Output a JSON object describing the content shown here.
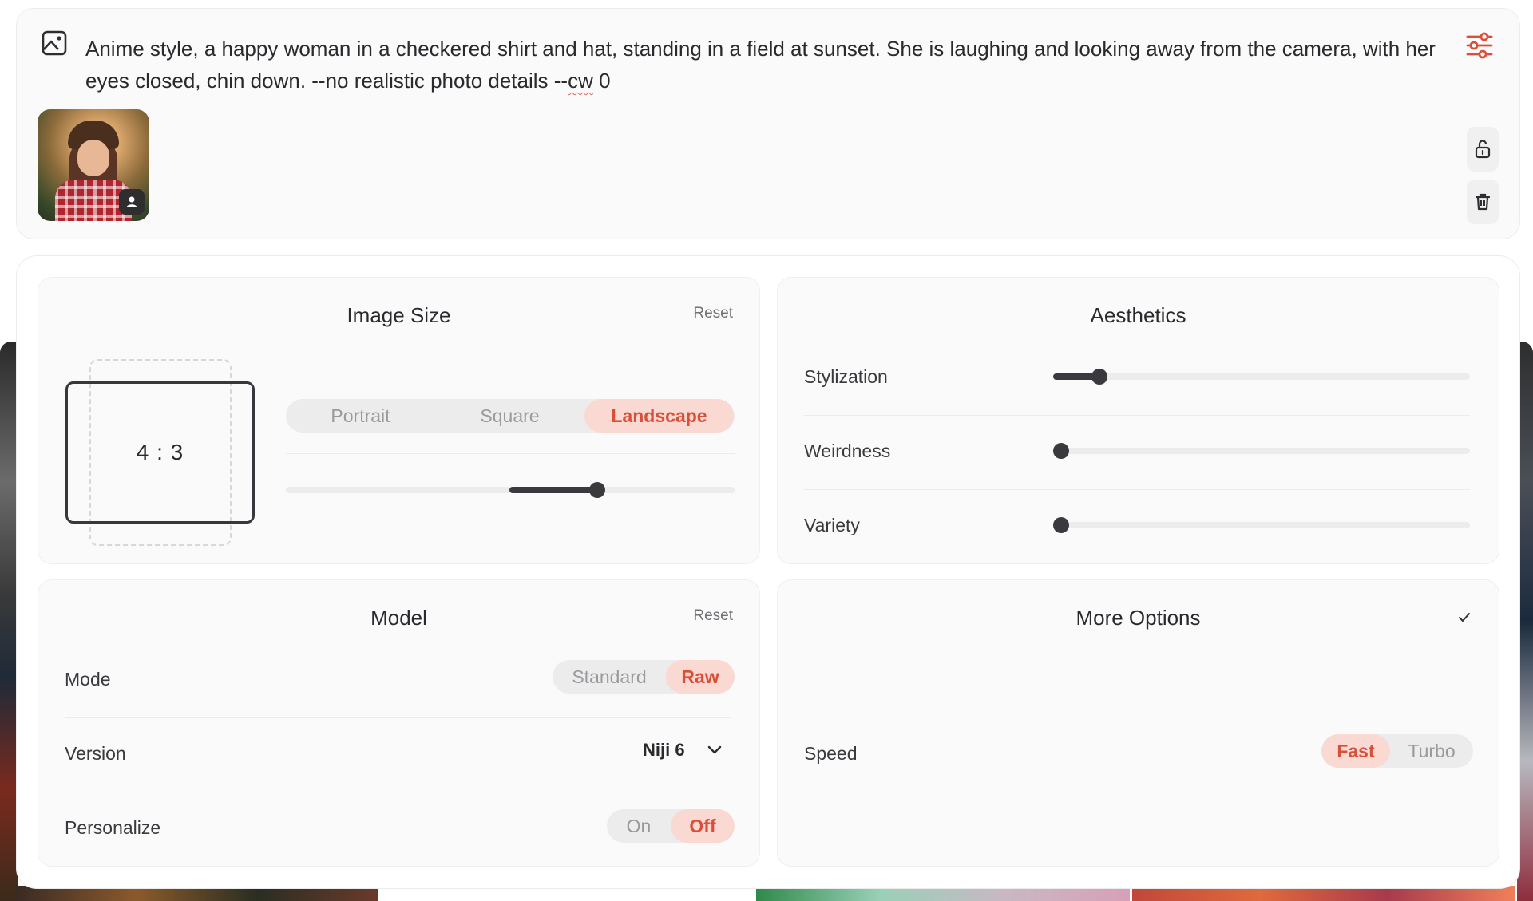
{
  "prompt": {
    "text_main": "Anime style, a happy woman in a checkered shirt and hat, standing in a field at sunset. She is laughing and looking away from the camera, with her eyes closed, chin down. --no realistic photo details --",
    "text_cw": "cw",
    "text_end": " 0"
  },
  "image_size": {
    "title": "Image Size",
    "reset": "Reset",
    "ratio": "4 : 3",
    "orientations": [
      "Portrait",
      "Square",
      "Landscape"
    ],
    "selected": "Landscape"
  },
  "aesthetics": {
    "title": "Aesthetics",
    "rows": [
      {
        "label": "Stylization",
        "value": 0.11
      },
      {
        "label": "Weirdness",
        "value": 0.0
      },
      {
        "label": "Variety",
        "value": 0.0
      }
    ]
  },
  "model": {
    "title": "Model",
    "reset": "Reset",
    "mode_label": "Mode",
    "modes": [
      "Standard",
      "Raw"
    ],
    "mode_selected": "Raw",
    "version_label": "Version",
    "version_value": "Niji 6",
    "personalize_label": "Personalize",
    "personalize_options": [
      "On",
      "Off"
    ],
    "personalize_selected": "Off"
  },
  "more_options": {
    "title": "More Options",
    "speed_label": "Speed",
    "speeds": [
      "Fast",
      "Turbo"
    ],
    "speed_selected": "Fast"
  },
  "colors": {
    "accent": "#d9503a",
    "accent_bg": "#fad9d3",
    "slider": "#3a3a3e"
  }
}
